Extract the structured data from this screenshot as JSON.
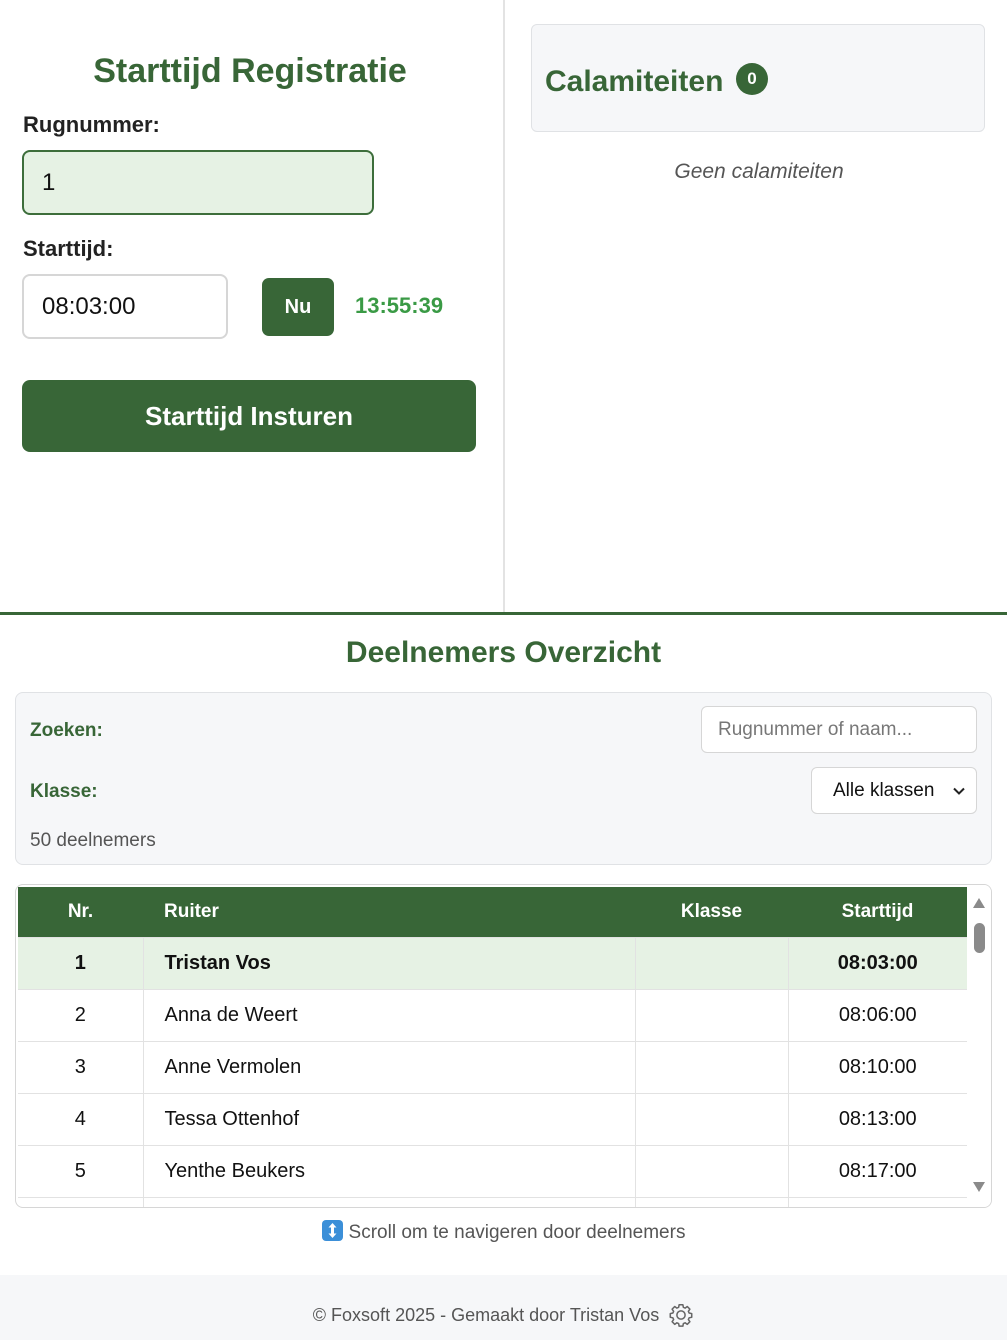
{
  "registration": {
    "title": "Starttijd Registratie",
    "rugnummer_label": "Rugnummer:",
    "rugnummer_value": "1",
    "starttijd_label": "Starttijd:",
    "starttijd_value": "08:03:00",
    "now_button": "Nu",
    "current_time": "13:55:39",
    "submit_button": "Starttijd Insturen"
  },
  "calamities": {
    "title": "Calamiteiten",
    "count": "0",
    "empty_text": "Geen calamiteiten"
  },
  "overview": {
    "title": "Deelnemers Overzicht",
    "search_label": "Zoeken:",
    "search_placeholder": "Rugnummer of naam...",
    "class_label": "Klasse:",
    "class_selected": "Alle klassen",
    "participant_count": "50 deelnemers"
  },
  "table": {
    "headers": {
      "nr": "Nr.",
      "ruiter": "Ruiter",
      "klasse": "Klasse",
      "starttijd": "Starttijd"
    },
    "rows": [
      {
        "nr": "1",
        "ruiter": "Tristan Vos",
        "klasse": "",
        "starttijd": "08:03:00"
      },
      {
        "nr": "2",
        "ruiter": "Anna de Weert",
        "klasse": "",
        "starttijd": "08:06:00"
      },
      {
        "nr": "3",
        "ruiter": "Anne Vermolen",
        "klasse": "",
        "starttijd": "08:10:00"
      },
      {
        "nr": "4",
        "ruiter": "Tessa Ottenhof",
        "klasse": "",
        "starttijd": "08:13:00"
      },
      {
        "nr": "5",
        "ruiter": "Yenthe Beukers",
        "klasse": "",
        "starttijd": "08:17:00"
      },
      {
        "nr": "",
        "ruiter": "",
        "klasse": "",
        "starttijd": ""
      }
    ]
  },
  "scroll_hint": "Scroll om te navigeren door deelnemers",
  "footer": {
    "text": "© Foxsoft 2025 - Gemaakt door Tristan Vos"
  },
  "colors": {
    "accent": "#386637",
    "clock": "#3a9a45",
    "active_row": "#e6f2e4"
  },
  "icons": {
    "scroll_hint": "up-down-arrow-icon",
    "settings": "gear-icon",
    "select": "chevron-down-icon"
  }
}
